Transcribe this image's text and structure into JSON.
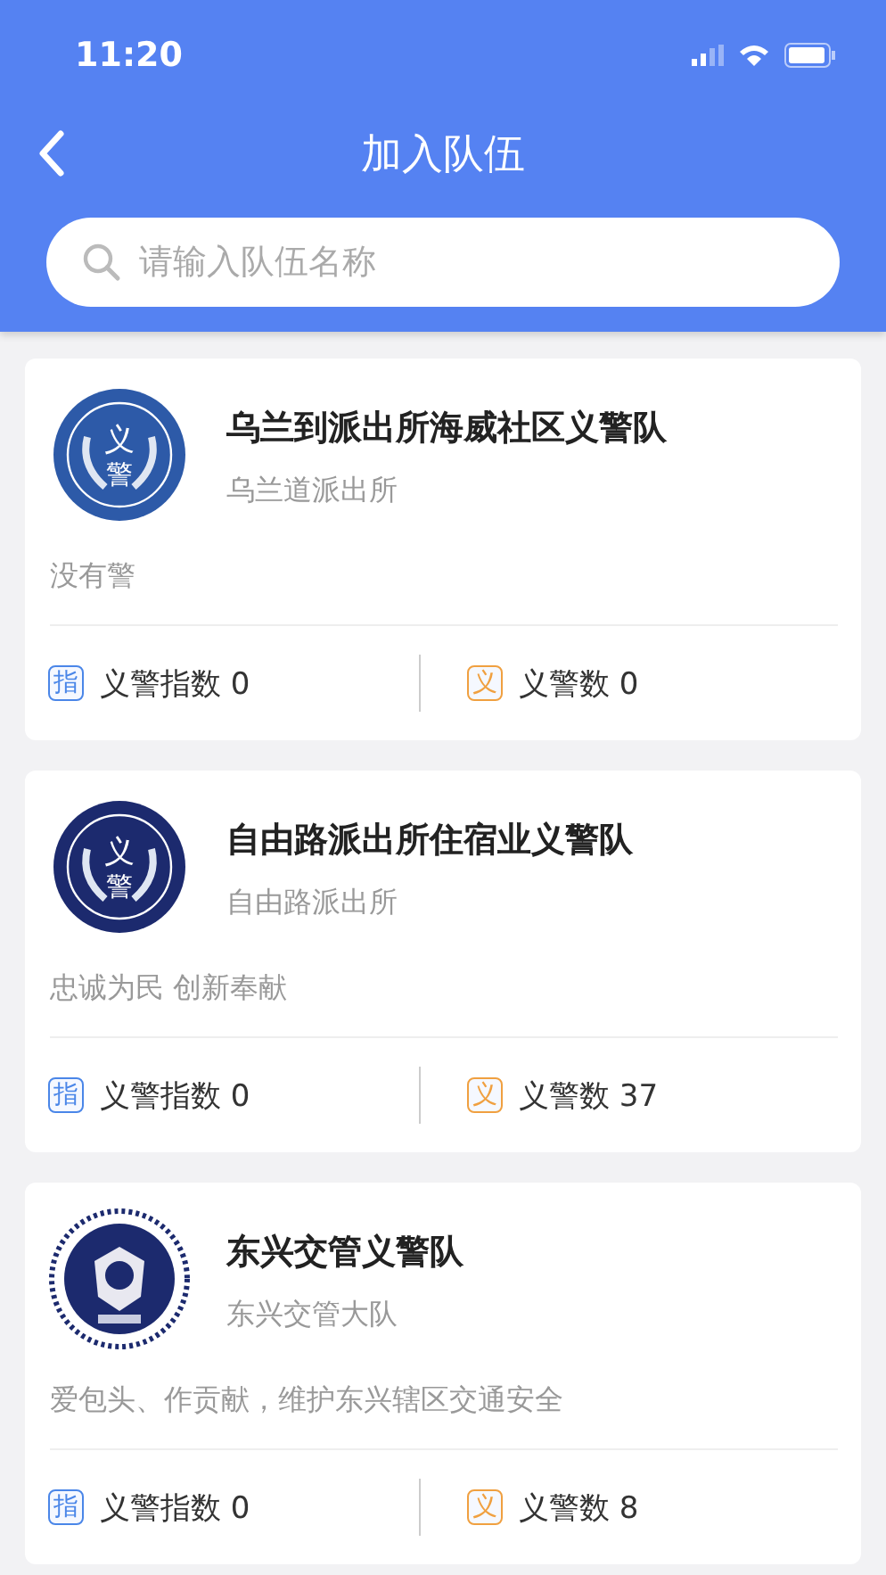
{
  "status_bar": {
    "time": "11:20"
  },
  "nav": {
    "title": "加入队伍"
  },
  "search": {
    "placeholder": "请输入队伍名称"
  },
  "teams": [
    {
      "kind": "blue_emblem",
      "emblem_text": [
        "义",
        "警"
      ],
      "name": "乌兰到派出所海威社区义警队",
      "station": "乌兰道派出所",
      "motto": "没有警",
      "stats": [
        {
          "kind": "index",
          "icon": "指",
          "label": "义警指数 0"
        },
        {
          "kind": "count",
          "icon": "义",
          "label": "义警数 0"
        }
      ]
    },
    {
      "kind": "navy_emblem",
      "emblem_text": [
        "义",
        "警"
      ],
      "name": "自由路派出所住宿业义警队",
      "station": "自由路派出所",
      "motto": "忠诚为民 创新奉献",
      "stats": [
        {
          "kind": "index",
          "icon": "指",
          "label": "义警指数 0"
        },
        {
          "kind": "count",
          "icon": "义",
          "label": "义警数 37"
        }
      ]
    },
    {
      "kind": "police_badge",
      "name": "东兴交管义警队",
      "station": "东兴交管大队",
      "motto": "爱包头、作贡献，维护东兴辖区交通安全",
      "stats": [
        {
          "kind": "index",
          "icon": "指",
          "label": "义警指数 0"
        },
        {
          "kind": "count",
          "icon": "义",
          "label": "义警数 8"
        }
      ]
    }
  ]
}
